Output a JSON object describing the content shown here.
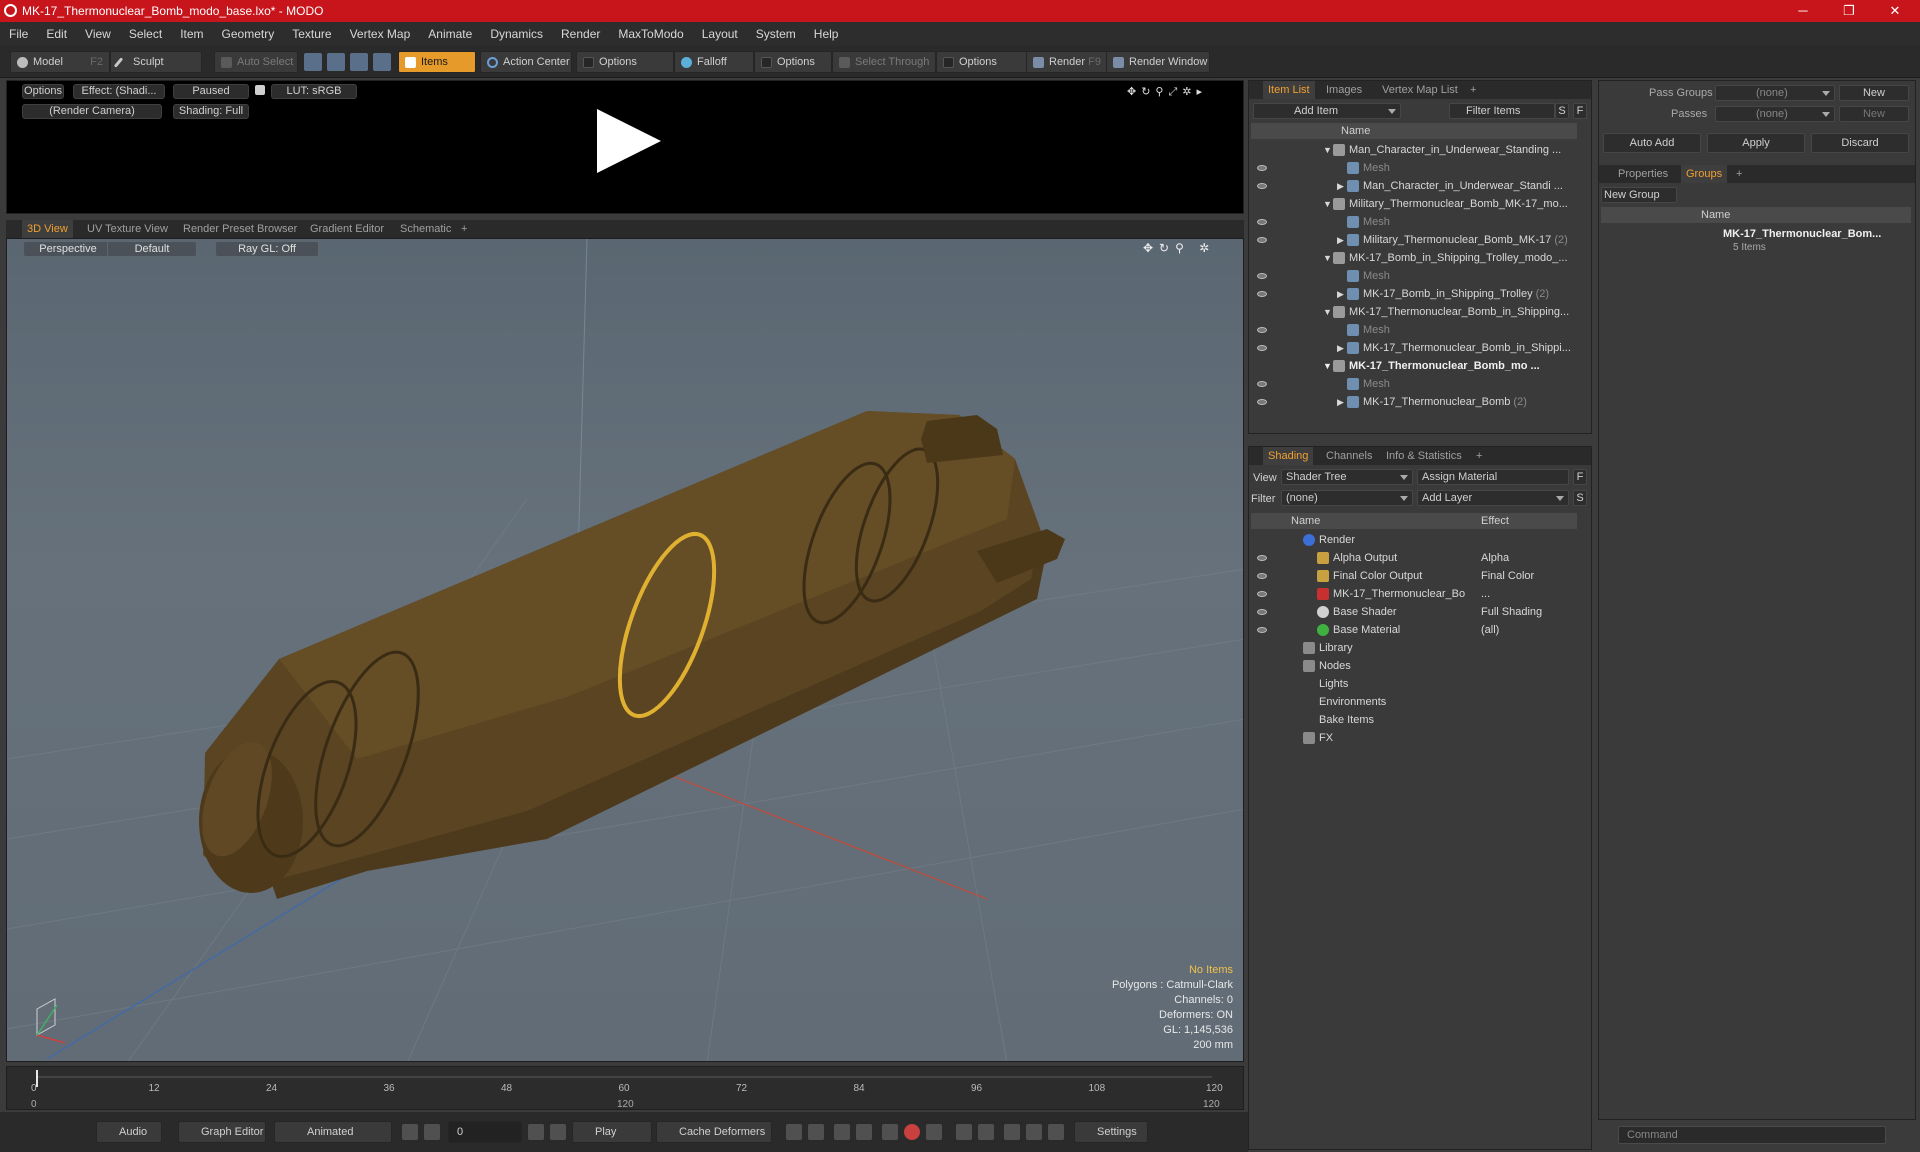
{
  "window": {
    "title": "MK-17_Thermonuclear_Bomb_modo_base.lxo* - MODO",
    "minimize": "─",
    "restore": "❐",
    "close": "✕"
  },
  "menu": [
    "File",
    "Edit",
    "View",
    "Select",
    "Item",
    "Geometry",
    "Texture",
    "Vertex Map",
    "Animate",
    "Dynamics",
    "Render",
    "MaxToModo",
    "Layout",
    "System",
    "Help"
  ],
  "toolbar": {
    "model": "Model",
    "model_key": "F2",
    "sculpt": "Sculpt",
    "auto_select": "Auto Select",
    "items": "Items",
    "action_center": "Action Center",
    "options1": "Options",
    "falloff": "Falloff",
    "options2": "Options",
    "select_through": "Select Through",
    "options3": "Options",
    "render": "Render",
    "render_key": "F9",
    "render_window": "Render Window"
  },
  "preview": {
    "options": "Options",
    "effect": "Effect: (Shadi...",
    "paused": "Paused",
    "lut": "LUT: sRGB",
    "camera": "(Render Camera)",
    "shading": "Shading: Full"
  },
  "view_tabs": [
    "3D View",
    "UV Texture View",
    "Render Preset Browser",
    "Gradient Editor",
    "Schematic",
    "+"
  ],
  "viewport": {
    "perspective": "Perspective",
    "default": "Default",
    "raygl": "Ray GL: Off",
    "stats": {
      "no_items": "No Items",
      "polygons": "Polygons : Catmull-Clark",
      "channels": "Channels: 0",
      "deformers": "Deformers: ON",
      "gl": "GL: 1,145,536",
      "scale": "200 mm"
    }
  },
  "timeline": {
    "ticks": [
      "0",
      "12",
      "24",
      "36",
      "48",
      "60",
      "72",
      "84",
      "96",
      "108",
      "120"
    ],
    "start": "0",
    "mid": "120",
    "end": "120"
  },
  "bottombar": {
    "audio": "Audio",
    "graph_editor": "Graph Editor",
    "animated": "Animated",
    "frame": "0",
    "play": "Play",
    "cache": "Cache Deformers",
    "settings": "Settings"
  },
  "item_list": {
    "tabs": [
      "Item List",
      "Images",
      "Vertex Map List",
      "+"
    ],
    "add_item": "Add Item",
    "filter": "Filter Items",
    "s": "S",
    "f": "F",
    "col_name": "Name",
    "rows": [
      {
        "label": "Man_Character_in_Underwear_Standing ...",
        "level": 1,
        "kind": "group"
      },
      {
        "label": "Mesh",
        "level": 2,
        "kind": "mesh"
      },
      {
        "label": "Man_Character_in_Underwear_Standi ...",
        "level": 2,
        "kind": "item"
      },
      {
        "label": "Military_Thermonuclear_Bomb_MK-17_mo...",
        "level": 1,
        "kind": "group"
      },
      {
        "label": "Mesh",
        "level": 2,
        "kind": "mesh"
      },
      {
        "label": "Military_Thermonuclear_Bomb_MK-17",
        "count": "(2)",
        "level": 2,
        "kind": "item"
      },
      {
        "label": "MK-17_Bomb_in_Shipping_Trolley_modo_...",
        "level": 1,
        "kind": "group"
      },
      {
        "label": "Mesh",
        "level": 2,
        "kind": "mesh"
      },
      {
        "label": "MK-17_Bomb_in_Shipping_Trolley",
        "count": "(2)",
        "level": 2,
        "kind": "item"
      },
      {
        "label": "MK-17_Thermonuclear_Bomb_in_Shipping...",
        "level": 1,
        "kind": "group"
      },
      {
        "label": "Mesh",
        "level": 2,
        "kind": "mesh"
      },
      {
        "label": "MK-17_Thermonuclear_Bomb_in_Shippi...",
        "level": 2,
        "kind": "item"
      },
      {
        "label": "MK-17_Thermonuclear_Bomb_mo ...",
        "level": 1,
        "kind": "group",
        "bold": true
      },
      {
        "label": "Mesh",
        "level": 2,
        "kind": "mesh"
      },
      {
        "label": "MK-17_Thermonuclear_Bomb",
        "count": "(2)",
        "level": 2,
        "kind": "item"
      }
    ]
  },
  "shading": {
    "tabs": [
      "Shading",
      "Channels",
      "Info & Statistics",
      "+"
    ],
    "view_label": "View",
    "view_value": "Shader Tree",
    "assign_material": "Assign Material",
    "f": "F",
    "filter_label": "Filter",
    "filter_value": "(none)",
    "add_layer": "Add Layer",
    "s": "S",
    "col_name": "Name",
    "col_effect": "Effect",
    "rows": [
      {
        "label": "Render",
        "effect": "",
        "level": 0,
        "icon": "#3c6ed8"
      },
      {
        "label": "Alpha Output",
        "effect": "Alpha",
        "level": 1,
        "icon": "#c8a040"
      },
      {
        "label": "Final Color Output",
        "effect": "Final Color",
        "level": 1,
        "icon": "#c8a040"
      },
      {
        "label": "MK-17_Thermonuclear_Bo",
        "effect": "...",
        "level": 1,
        "icon": "#c83030"
      },
      {
        "label": "Base Shader",
        "effect": "Full Shading",
        "level": 1,
        "icon": "#d0d0d0"
      },
      {
        "label": "Base Material",
        "effect": "(all)",
        "level": 1,
        "icon": "#40b040"
      },
      {
        "label": "Library",
        "effect": "",
        "level": 0,
        "icon": "#8a8a8a"
      },
      {
        "label": "Nodes",
        "effect": "",
        "level": 0,
        "icon": "#8a8a8a"
      },
      {
        "label": "Lights",
        "effect": "",
        "level": 0,
        "icon": ""
      },
      {
        "label": "Environments",
        "effect": "",
        "level": 0,
        "icon": ""
      },
      {
        "label": "Bake Items",
        "effect": "",
        "level": 0,
        "icon": ""
      },
      {
        "label": "FX",
        "effect": "",
        "level": 0,
        "icon": "#8a8a8a"
      }
    ]
  },
  "groups_panel": {
    "pass_groups_label": "Pass Groups",
    "pass_groups_value": "(none)",
    "passes_label": "Passes",
    "passes_value": "(none)",
    "new1": "New",
    "new2": "New",
    "auto_add": "Auto Add",
    "apply": "Apply",
    "discard": "Discard",
    "tabs": [
      "Properties",
      "Groups",
      "+"
    ],
    "new_group": "New Group",
    "col_name": "Name",
    "group_name": "MK-17_Thermonuclear_Bom...",
    "group_items": "5 Items"
  },
  "command": {
    "placeholder": "Command"
  }
}
